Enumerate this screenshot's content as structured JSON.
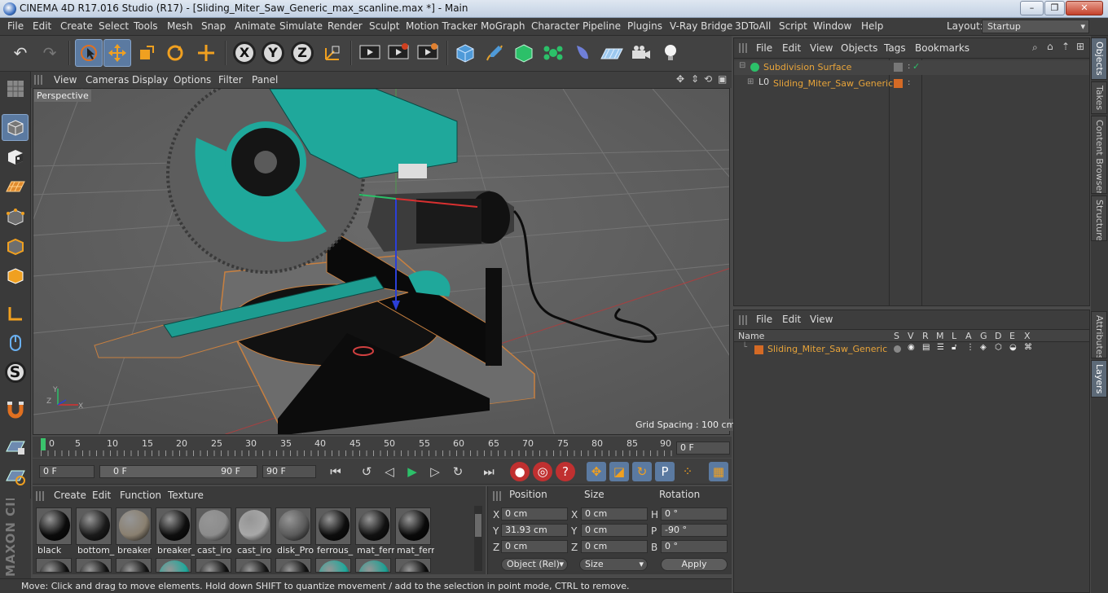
{
  "window": {
    "title": "CINEMA 4D R17.016 Studio (R17) - [Sliding_Miter_Saw_Generic_max_scanline.max *] - Main",
    "minimize": "–",
    "restore": "❐",
    "close": "✕"
  },
  "menubar": {
    "items": [
      "File",
      "Edit",
      "Create",
      "Select",
      "Tools",
      "Mesh",
      "Snap",
      "Animate",
      "Simulate",
      "Render",
      "Sculpt",
      "Motion Tracker",
      "MoGraph",
      "Character",
      "Pipeline",
      "Plugins",
      "V-Ray Bridge",
      "3DToAll",
      "Script",
      "Window",
      "Help"
    ],
    "layout_label": "Layout:",
    "layout_value": "Startup"
  },
  "toolbar": {
    "axis_x": "X",
    "axis_y": "Y",
    "axis_z": "Z"
  },
  "viewport": {
    "menu": [
      "View",
      "Cameras",
      "Display",
      "Options",
      "Filter",
      "Panel"
    ],
    "label": "Perspective",
    "grid_spacing": "Grid Spacing : 100 cm",
    "axis_x": "X",
    "axis_y": "Y",
    "axis_z": "Z"
  },
  "timeline": {
    "ticks": [
      "0",
      "5",
      "10",
      "15",
      "20",
      "25",
      "30",
      "35",
      "40",
      "45",
      "50",
      "55",
      "60",
      "65",
      "70",
      "75",
      "80",
      "85",
      "90"
    ],
    "current_frame": "0 F"
  },
  "transport": {
    "start_field": "0 F",
    "range_start": "0 F",
    "range_end": "90 F",
    "end_field": "90 F"
  },
  "material_panel": {
    "menu": [
      "Create",
      "Edit",
      "Function",
      "Texture"
    ],
    "materials": [
      {
        "label": "black",
        "color": "#0b0b0b"
      },
      {
        "label": "bottom_",
        "color": "#1a1a1a"
      },
      {
        "label": "breaker",
        "color": "#8a8070"
      },
      {
        "label": "breaker_",
        "color": "#0e0e0e"
      },
      {
        "label": "cast_iro",
        "color": "#8c8c8c"
      },
      {
        "label": "cast_iro",
        "color": "#a8a8a8"
      },
      {
        "label": "disk_Pro",
        "color": "#5a5a5a"
      },
      {
        "label": "ferrous_",
        "color": "#0d0d0d"
      },
      {
        "label": "mat_ferr",
        "color": "#111111"
      },
      {
        "label": "mat_ferr",
        "color": "#0a0a0a"
      }
    ],
    "row2_colors": [
      "#0e0e0e",
      "#111111",
      "#121212",
      "#1fa89b",
      "#0f0f0f",
      "#131313",
      "#111111",
      "#1fa89b",
      "#1ca093",
      "#0c0c0c"
    ]
  },
  "coordinates": {
    "headers": {
      "position": "Position",
      "size": "Size",
      "rotation": "Rotation"
    },
    "rows": [
      {
        "pos_axis": "X",
        "pos": "0 cm",
        "size_axis": "X",
        "size": "0 cm",
        "rot_axis": "H",
        "rot": "0 °"
      },
      {
        "pos_axis": "Y",
        "pos": "31.93 cm",
        "size_axis": "Y",
        "size": "0 cm",
        "rot_axis": "P",
        "rot": "-90 °"
      },
      {
        "pos_axis": "Z",
        "pos": "0 cm",
        "size_axis": "Z",
        "size": "0 cm",
        "rot_axis": "B",
        "rot": "0 °"
      }
    ],
    "mode_select": "Object (Rel)",
    "size_select": "Size",
    "apply": "Apply"
  },
  "status": "Move: Click and drag to move elements. Hold down SHIFT to quantize movement / add to the selection in point mode, CTRL to remove.",
  "object_manager": {
    "menu": [
      "File",
      "Edit",
      "View",
      "Objects",
      "Tags",
      "Bookmarks"
    ],
    "objects": [
      {
        "name": "Subdivision Surface"
      },
      {
        "name": "Sliding_Miter_Saw_Generic"
      }
    ]
  },
  "layer_manager": {
    "menu": [
      "File",
      "Edit",
      "View"
    ],
    "columns": [
      "Name",
      "S",
      "V",
      "R",
      "M",
      "L",
      "A",
      "G",
      "D",
      "E",
      "X"
    ],
    "layers": [
      {
        "name": "Sliding_Miter_Saw_Generic",
        "color": "#d46a25"
      }
    ]
  },
  "side_tabs": [
    "Objects",
    "Takes",
    "Content Browser",
    "Structure",
    "Attributes",
    "Layers"
  ],
  "maxon_logo": "MAXON CINEMA 4D",
  "colors": {
    "accent": "#5b7aa1",
    "teal": "#1fa89b",
    "orange": "#d46a25"
  }
}
